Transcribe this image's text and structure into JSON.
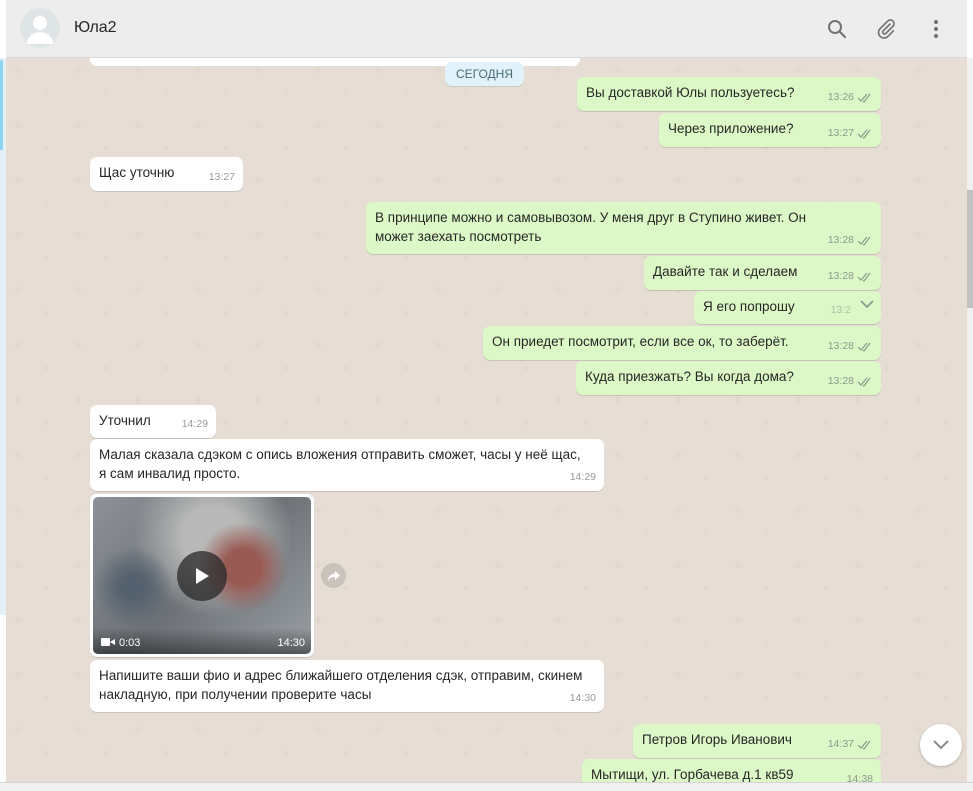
{
  "header": {
    "contact_name": "Юла2",
    "icons": [
      "search-icon",
      "attach-icon",
      "menu-icon"
    ]
  },
  "chat": {
    "date_separator": "СЕГОДНЯ",
    "messages": [
      {
        "dir": "out",
        "text": "Вы доставкой Юлы пользуетесь?",
        "time": "13:26"
      },
      {
        "dir": "out",
        "text": "Через приложение?",
        "time": "13:27"
      },
      {
        "dir": "in",
        "text": "Щас уточню",
        "time": "13:27"
      },
      {
        "dir": "out",
        "text": "В принципе можно и самовывозом. У меня друг в Ступино живет. Он может заехать посмотреть",
        "time": "13:28"
      },
      {
        "dir": "out",
        "text": "Давайте так и сделаем",
        "time": "13:28"
      },
      {
        "dir": "out",
        "text": "Я его попрошу",
        "time": "13:2"
      },
      {
        "dir": "out",
        "text": "Он приедет посмотрит, если все ок, то заберёт.",
        "time": "13:28"
      },
      {
        "dir": "out",
        "text": "Куда приезжать? Вы когда дома?",
        "time": "13:28"
      },
      {
        "dir": "in",
        "text": "Уточнил",
        "time": "14:29"
      },
      {
        "dir": "in",
        "text": "Малая сказала сдэком с опись вложения отправить сможет, часы у неё щас, я сам инвалид просто.",
        "time": "14:29"
      },
      {
        "dir": "in",
        "type": "video",
        "duration": "0:03",
        "time": "14:30"
      },
      {
        "dir": "in",
        "text": "Напишите ваши фио и адрес ближайшего отделения сдэк, отправим, скинем накладную, при получении проверите часы",
        "time": "14:30"
      },
      {
        "dir": "out",
        "text": "Петров Игорь Иванович",
        "time": "14:37"
      },
      {
        "dir": "out",
        "text": "Мытищи, ул. Горбачева д.1 кв59",
        "time": "14:38"
      }
    ]
  },
  "colors": {
    "outgoing_bubble": "#dcf8c6",
    "incoming_bubble": "#ffffff",
    "chat_background": "#e6ded5",
    "header_background": "#ededed",
    "read_ticks": "#8c9a8c"
  }
}
